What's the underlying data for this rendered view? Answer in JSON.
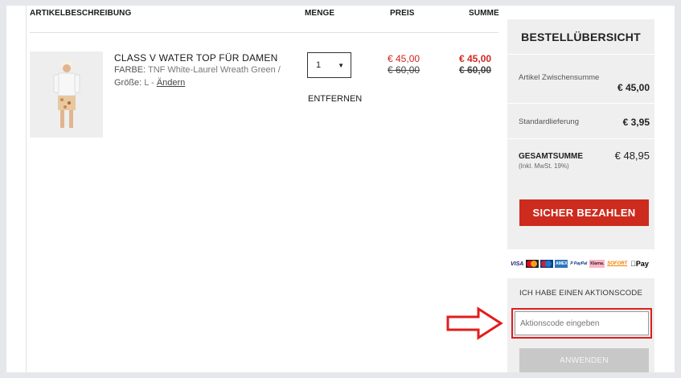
{
  "cart": {
    "headers": {
      "description": "ARTIKELBESCHREIBUNG",
      "quantity": "MENGE",
      "price": "PREIS",
      "sum": "SUMME"
    },
    "item": {
      "title": "CLASS V WATER TOP FÜR DAMEN",
      "color_label": "FARBE:",
      "color_value": "TNF White-Laurel Wreath Green",
      "separator": "/",
      "size_label": "Größe:",
      "size_value": "L",
      "dash": "-",
      "change_link": "Ändern",
      "quantity": "1",
      "remove_label": "ENTFERNEN",
      "price_now": "€ 45,00",
      "price_old": "€ 60,00",
      "sum_now": "€ 45,00",
      "sum_old": "€ 60,00"
    }
  },
  "summary": {
    "title": "BESTELLÜBERSICHT",
    "subtotal_label": "Artikel Zwischensumme",
    "subtotal_value": "€ 45,00",
    "shipping_label": "Standardlieferung",
    "shipping_value": "€ 3,95",
    "total_label": "GESAMTSUMME",
    "total_note": "(Inkl. MwSt. 19%)",
    "total_value": "€ 48,95",
    "pay_button": "SICHER BEZAHLEN",
    "payment_methods": {
      "visa": "VISA",
      "amex": "AMEX",
      "paypal": "P PayPal",
      "klarna": "Klarna.",
      "sofort": "SOFORT",
      "apple_pay": "Pay"
    },
    "promo_title": "ICH HABE EINEN AKTIONSCODE",
    "promo_placeholder": "Aktionscode eingeben",
    "apply_button": "ANWENDEN"
  },
  "colors": {
    "accent_red": "#cc2b1e",
    "price_red": "#d1261e",
    "highlight_red": "#e11d1d",
    "panel_gray": "#efefef"
  }
}
